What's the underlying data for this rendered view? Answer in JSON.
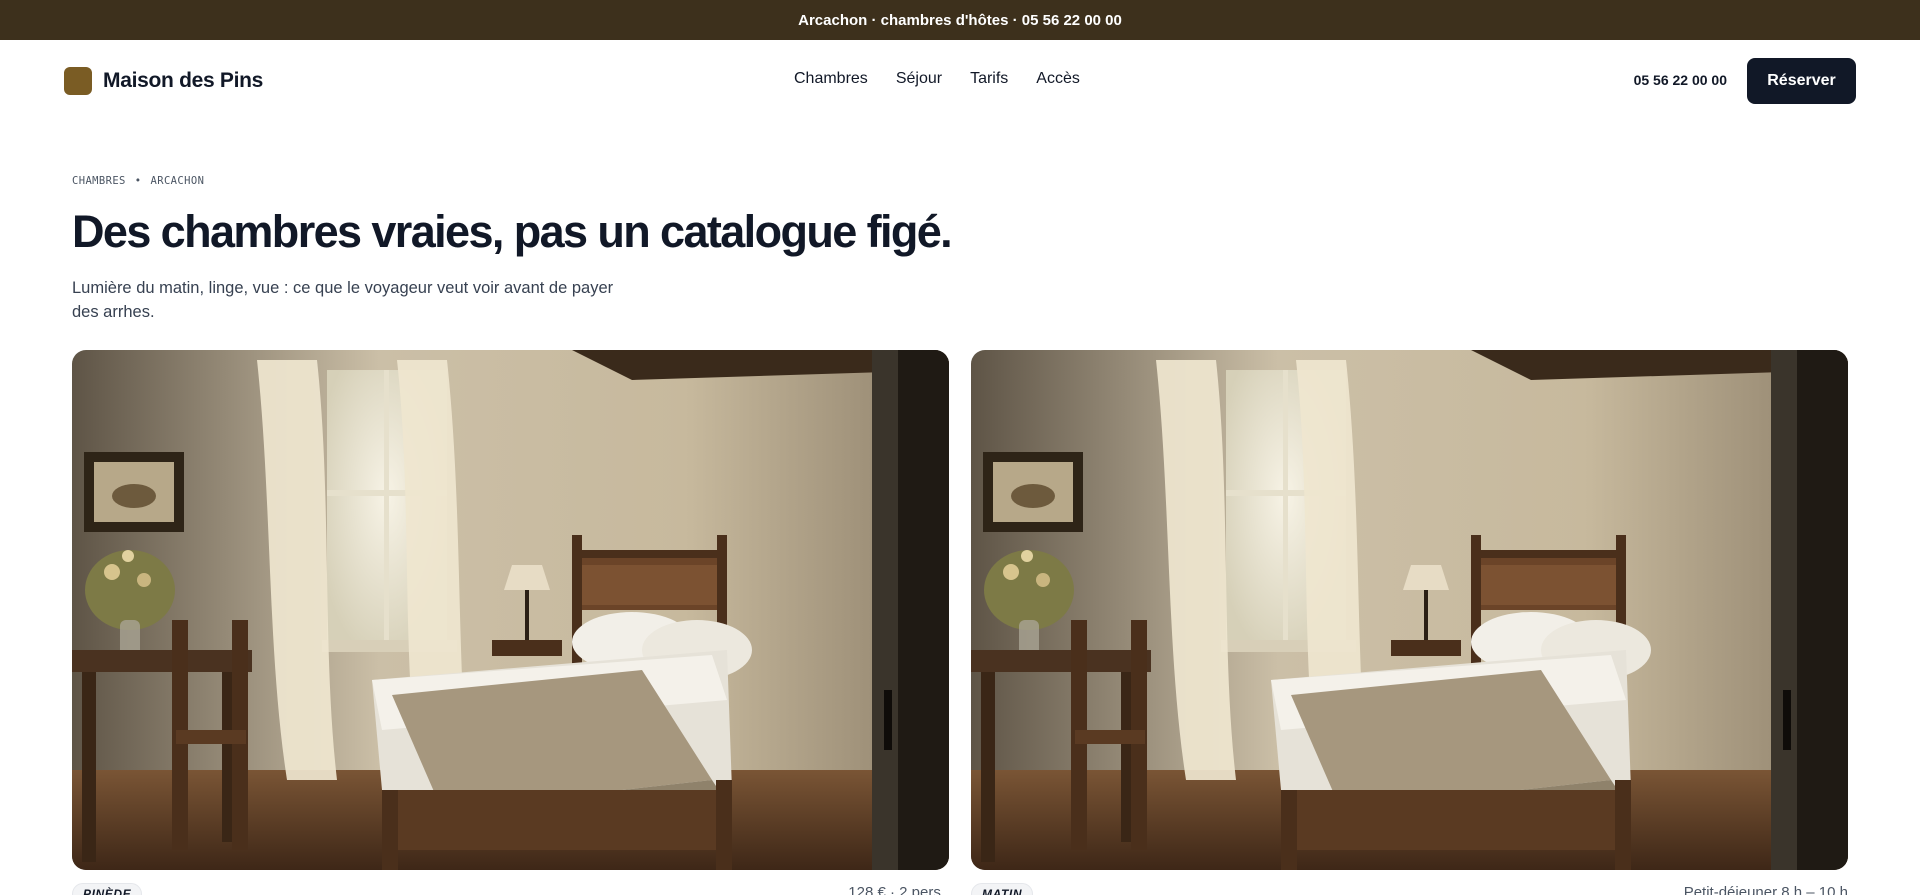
{
  "topbar": {
    "text": "Arcachon · chambres d'hôtes · 05 56 22 00 00"
  },
  "header": {
    "brand": "Maison des Pins",
    "nav": [
      "Chambres",
      "Séjour",
      "Tarifs",
      "Accès"
    ],
    "phone": "05 56 22 00 00",
    "cta": "Réserver"
  },
  "hero": {
    "breadcrumb": [
      "CHAMBRES",
      "•",
      "ARCACHON"
    ],
    "title": "Des chambres vraies, pas un catalogue figé.",
    "subtitle": "Lumière du matin, linge, vue : ce que le voyageur veut voir avant de payer des arrhes."
  },
  "cards": [
    {
      "tag": "PINÈDE",
      "meta": "128 € · 2 pers."
    },
    {
      "tag": "MATIN",
      "meta": "Petit-déjeuner 8 h – 10 h"
    }
  ],
  "colors": {
    "topbar": "#3d301c",
    "brand_mark": "#7a5c24",
    "button": "#111827"
  }
}
